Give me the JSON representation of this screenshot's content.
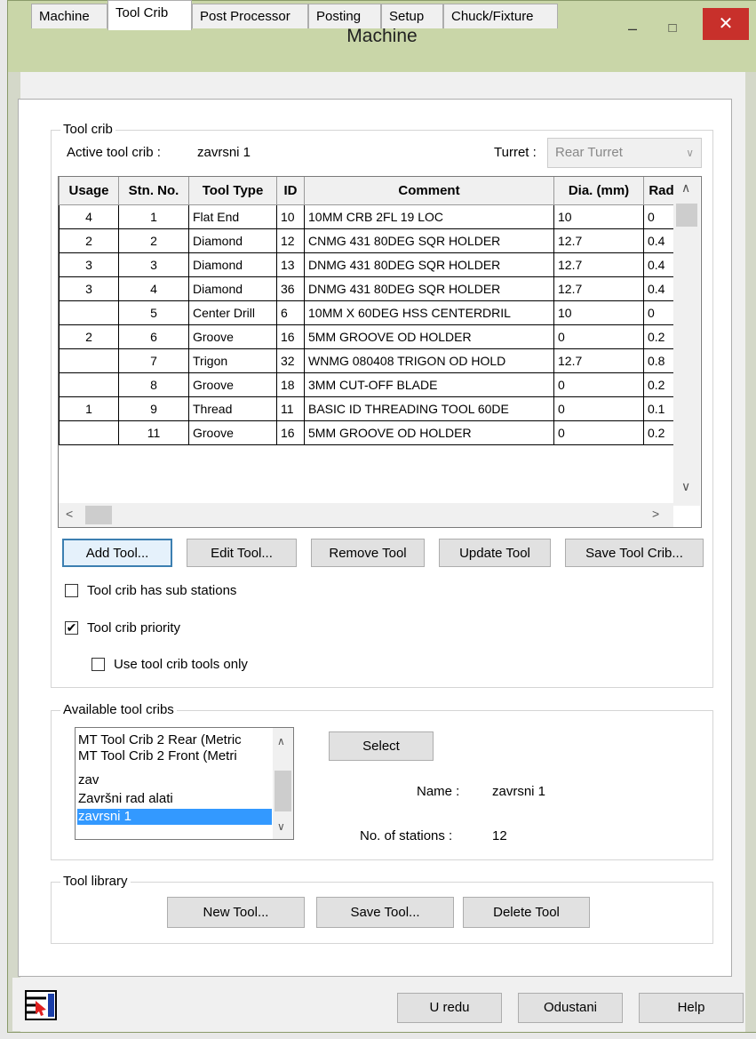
{
  "window": {
    "title": "Machine"
  },
  "tabs": [
    "Machine",
    "Tool Crib",
    "Post Processor",
    "Posting",
    "Setup",
    "Chuck/Fixture"
  ],
  "tool_crib_group": {
    "label": "Tool crib",
    "active_label": "Active tool crib :",
    "active_value": "zavrsni 1",
    "turret_label": "Turret :",
    "turret_value": "Rear Turret"
  },
  "table": {
    "headers": [
      "Usage",
      "Stn. No.",
      "Tool Type",
      "ID",
      "Comment",
      "Dia. (mm)",
      "Rad"
    ],
    "rows": [
      [
        "4",
        "1",
        "Flat End",
        "10",
        "10MM CRB 2FL 19 LOC",
        "10",
        "0"
      ],
      [
        "2",
        "2",
        "Diamond",
        "12",
        "CNMG 431 80DEG SQR HOLDER",
        "12.7",
        "0.4"
      ],
      [
        "3",
        "3",
        "Diamond",
        "13",
        "DNMG 431 80DEG SQR HOLDER",
        "12.7",
        "0.4"
      ],
      [
        "3",
        "4",
        "Diamond",
        "36",
        "DNMG 431 80DEG SQR HOLDER",
        "12.7",
        "0.4"
      ],
      [
        "",
        "5",
        "Center Drill",
        "6",
        "10MM X 60DEG HSS CENTERDRIL",
        "10",
        "0"
      ],
      [
        "2",
        "6",
        "Groove",
        "16",
        "5MM GROOVE OD HOLDER",
        "0",
        "0.2"
      ],
      [
        "",
        "7",
        "Trigon",
        "32",
        "WNMG 080408 TRIGON OD HOLD",
        "12.7",
        "0.8"
      ],
      [
        "",
        "8",
        "Groove",
        "18",
        "3MM CUT-OFF BLADE",
        "0",
        "0.2"
      ],
      [
        "1",
        "9",
        "Thread",
        "11",
        "BASIC ID THREADING TOOL 60DE",
        "0",
        "0.1"
      ],
      [
        "",
        "11",
        "Groove",
        "16",
        "5MM GROOVE OD HOLDER",
        "0",
        "0.2"
      ]
    ]
  },
  "buttons": {
    "add_tool": "Add Tool...",
    "edit_tool": "Edit Tool...",
    "remove_tool": "Remove Tool",
    "update_tool": "Update Tool",
    "save_tool_crib": "Save Tool Crib...",
    "select": "Select",
    "new_tool": "New Tool...",
    "save_tool": "Save Tool...",
    "delete_tool": "Delete Tool",
    "ok": "U redu",
    "cancel": "Odustani",
    "help": "Help"
  },
  "checkboxes": {
    "sub_stations": {
      "label": "Tool crib has sub stations",
      "checked": false
    },
    "priority": {
      "label": "Tool crib priority",
      "checked": true
    },
    "crib_only": {
      "label": "Use tool crib tools only",
      "checked": false
    }
  },
  "available_group": {
    "label": "Available tool cribs",
    "items": [
      "MT Tool Crib 2 Rear (Metric",
      "MT Tool Crib 2 Front (Metri",
      "zav",
      "Završni rad alati",
      "zavrsni 1"
    ],
    "selected_index": 4,
    "name_label": "Name :",
    "name_value": "zavrsni 1",
    "stations_label": "No. of stations :",
    "stations_value": "12"
  },
  "library_group": {
    "label": "Tool library"
  },
  "icons": {
    "minimize": "minimize-icon",
    "maximize": "maximize-icon",
    "close": "close-icon",
    "app": "tool-crib-app-icon"
  },
  "colors": {
    "titlebar": "#c9d6a8",
    "close": "#c8302b",
    "selection": "#3399ff"
  }
}
